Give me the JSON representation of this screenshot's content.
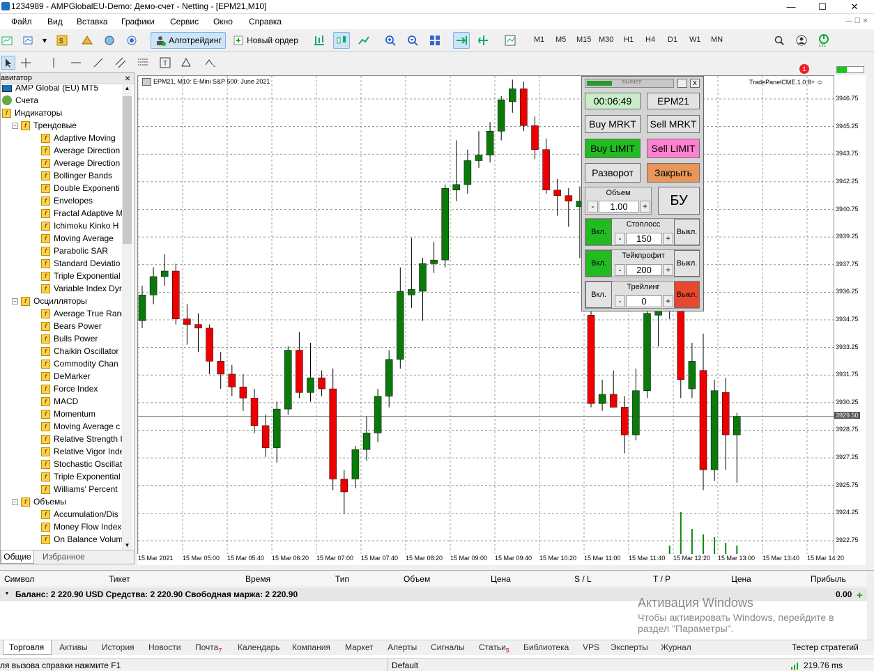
{
  "window": {
    "title": "1234989 - AMPGlobalEU-Demo: Демо-счет - Netting - [EPM21,M10]",
    "minimize": "—",
    "maximize": "☐",
    "close": "✕"
  },
  "menu": [
    "Файл",
    "Вид",
    "Вставка",
    "Графики",
    "Сервис",
    "Окно",
    "Справка"
  ],
  "toolbar": {
    "algotrading": "Алготрейдинг",
    "new_order": "Новый ордер",
    "timeframes": [
      "M1",
      "M5",
      "M15",
      "M30",
      "H1",
      "H4",
      "D1",
      "W1",
      "MN"
    ],
    "notification_count": "1"
  },
  "navigator": {
    "title": "авигатор",
    "close": "×",
    "tabs": [
      "Общие",
      "Избранное"
    ],
    "items": [
      {
        "label": "AMP Global (EU) MT5",
        "level": 0,
        "icon": "terminal-icon"
      },
      {
        "label": "Счета",
        "level": 0,
        "icon": "accounts-icon"
      },
      {
        "label": "Индикаторы",
        "level": 0,
        "icon": "indicator-icon"
      },
      {
        "label": "Трендовые",
        "level": 1,
        "icon": "indicator-icon"
      },
      {
        "label": "Adaptive Moving",
        "level": 2,
        "icon": "indicator-icon"
      },
      {
        "label": "Average Direction",
        "level": 2,
        "icon": "indicator-icon"
      },
      {
        "label": "Average Direction",
        "level": 2,
        "icon": "indicator-icon"
      },
      {
        "label": "Bollinger Bands",
        "level": 2,
        "icon": "indicator-icon"
      },
      {
        "label": "Double Exponenti",
        "level": 2,
        "icon": "indicator-icon"
      },
      {
        "label": "Envelopes",
        "level": 2,
        "icon": "indicator-icon"
      },
      {
        "label": "Fractal Adaptive M",
        "level": 2,
        "icon": "indicator-icon"
      },
      {
        "label": "Ichimoku Kinko H",
        "level": 2,
        "icon": "indicator-icon"
      },
      {
        "label": "Moving Average",
        "level": 2,
        "icon": "indicator-icon"
      },
      {
        "label": "Parabolic SAR",
        "level": 2,
        "icon": "indicator-icon"
      },
      {
        "label": "Standard Deviatio",
        "level": 2,
        "icon": "indicator-icon"
      },
      {
        "label": "Triple Exponential",
        "level": 2,
        "icon": "indicator-icon"
      },
      {
        "label": "Variable Index Dyr",
        "level": 2,
        "icon": "indicator-icon"
      },
      {
        "label": "Осцилляторы",
        "level": 1,
        "icon": "indicator-icon"
      },
      {
        "label": "Average True Rang",
        "level": 2,
        "icon": "indicator-icon"
      },
      {
        "label": "Bears Power",
        "level": 2,
        "icon": "indicator-icon"
      },
      {
        "label": "Bulls Power",
        "level": 2,
        "icon": "indicator-icon"
      },
      {
        "label": "Chaikin Oscillator",
        "level": 2,
        "icon": "indicator-icon"
      },
      {
        "label": "Commodity Chan",
        "level": 2,
        "icon": "indicator-icon"
      },
      {
        "label": "DeMarker",
        "level": 2,
        "icon": "indicator-icon"
      },
      {
        "label": "Force Index",
        "level": 2,
        "icon": "indicator-icon"
      },
      {
        "label": "MACD",
        "level": 2,
        "icon": "indicator-icon"
      },
      {
        "label": "Momentum",
        "level": 2,
        "icon": "indicator-icon"
      },
      {
        "label": "Moving Average c",
        "level": 2,
        "icon": "indicator-icon"
      },
      {
        "label": "Relative Strength I",
        "level": 2,
        "icon": "indicator-icon"
      },
      {
        "label": "Relative Vigor Inde",
        "level": 2,
        "icon": "indicator-icon"
      },
      {
        "label": "Stochastic Oscillat",
        "level": 2,
        "icon": "indicator-icon"
      },
      {
        "label": "Triple Exponential",
        "level": 2,
        "icon": "indicator-icon"
      },
      {
        "label": "Williams' Percent",
        "level": 2,
        "icon": "indicator-icon"
      },
      {
        "label": "Объемы",
        "level": 1,
        "icon": "indicator-icon"
      },
      {
        "label": "Accumulation/Dis",
        "level": 2,
        "icon": "indicator-icon"
      },
      {
        "label": "Money Flow Index",
        "level": 2,
        "icon": "indicator-icon"
      },
      {
        "label": "On Balance Volum",
        "level": 2,
        "icon": "indicator-icon"
      }
    ]
  },
  "chart": {
    "info": "EPM21, M10:  E-Mini S&P 500: June 2021",
    "tradepanel_label": "TradePanelCME.1.0.8+",
    "price_labels": [
      "3946.75",
      "3945.25",
      "3943.75",
      "3942.25",
      "3940.75",
      "3939.25",
      "3937.75",
      "3936.25",
      "3934.75",
      "3933.25",
      "3931.75",
      "3930.25",
      "3928.75",
      "3927.25",
      "3925.75",
      "3924.25",
      "3922.75"
    ],
    "current_price": "3929.50",
    "time_labels": [
      "15 Mar 2021",
      "15 Mar 05:00",
      "15 Mar 05:40",
      "15 Mar 06:20",
      "15 Mar 07:00",
      "15 Mar 07:40",
      "15 Mar 08:20",
      "15 Mar 09:00",
      "15 Mar 09:40",
      "15 Mar 10:20",
      "15 Mar 11:00",
      "15 Mar 11:40",
      "15 Mar 12:20",
      "15 Mar 13:00",
      "15 Mar 13:40",
      "15 Mar 14:20"
    ],
    "colors": {
      "bull": "#0a7a0a",
      "bear": "#ee0000",
      "grid": "#777777",
      "volume": "#0a8a0a"
    }
  },
  "chart_data": {
    "type": "candlestick",
    "y_range": [
      3921.5,
      3948.0
    ],
    "candles": [
      {
        "o": 3934.7,
        "h": 3936.6,
        "l": 3934.3,
        "c": 3936.1
      },
      {
        "o": 3936.1,
        "h": 3937.6,
        "l": 3935.6,
        "c": 3937.1
      },
      {
        "o": 3937.1,
        "h": 3938.3,
        "l": 3936.6,
        "c": 3937.4
      },
      {
        "o": 3937.4,
        "h": 3937.8,
        "l": 3934.5,
        "c": 3934.8
      },
      {
        "o": 3934.8,
        "h": 3935.6,
        "l": 3933.4,
        "c": 3934.5
      },
      {
        "o": 3934.5,
        "h": 3935.1,
        "l": 3933.0,
        "c": 3934.3
      },
      {
        "o": 3934.3,
        "h": 3934.5,
        "l": 3931.8,
        "c": 3932.5
      },
      {
        "o": 3932.5,
        "h": 3933.0,
        "l": 3931.0,
        "c": 3931.8
      },
      {
        "o": 3931.8,
        "h": 3932.3,
        "l": 3930.6,
        "c": 3931.1
      },
      {
        "o": 3931.1,
        "h": 3931.8,
        "l": 3929.8,
        "c": 3930.5
      },
      {
        "o": 3930.5,
        "h": 3931.0,
        "l": 3928.6,
        "c": 3929.0
      },
      {
        "o": 3929.0,
        "h": 3929.6,
        "l": 3927.3,
        "c": 3927.8
      },
      {
        "o": 3927.8,
        "h": 3930.3,
        "l": 3927.0,
        "c": 3929.9
      },
      {
        "o": 3929.9,
        "h": 3933.3,
        "l": 3929.6,
        "c": 3933.1
      },
      {
        "o": 3933.1,
        "h": 3934.1,
        "l": 3930.5,
        "c": 3930.8
      },
      {
        "o": 3930.8,
        "h": 3933.5,
        "l": 3930.3,
        "c": 3931.6
      },
      {
        "o": 3931.6,
        "h": 3932.0,
        "l": 3930.6,
        "c": 3931.0
      },
      {
        "o": 3931.0,
        "h": 3932.1,
        "l": 3925.5,
        "c": 3926.1
      },
      {
        "o": 3926.1,
        "h": 3926.6,
        "l": 3924.2,
        "c": 3925.4
      },
      {
        "o": 3926.1,
        "h": 3927.9,
        "l": 3925.6,
        "c": 3927.7
      },
      {
        "o": 3927.7,
        "h": 3929.5,
        "l": 3927.1,
        "c": 3928.6
      },
      {
        "o": 3928.6,
        "h": 3931.0,
        "l": 3928.1,
        "c": 3930.6
      },
      {
        "o": 3930.6,
        "h": 3933.1,
        "l": 3930.0,
        "c": 3932.6
      },
      {
        "o": 3932.6,
        "h": 3937.6,
        "l": 3932.1,
        "c": 3936.3
      },
      {
        "o": 3936.1,
        "h": 3939.2,
        "l": 3935.4,
        "c": 3936.4
      },
      {
        "o": 3936.3,
        "h": 3938.1,
        "l": 3934.7,
        "c": 3937.8
      },
      {
        "o": 3937.8,
        "h": 3939.0,
        "l": 3937.3,
        "c": 3938.0
      },
      {
        "o": 3938.0,
        "h": 3942.1,
        "l": 3937.6,
        "c": 3941.9
      },
      {
        "o": 3941.8,
        "h": 3944.5,
        "l": 3941.2,
        "c": 3942.1
      },
      {
        "o": 3942.1,
        "h": 3944.0,
        "l": 3941.6,
        "c": 3943.4
      },
      {
        "o": 3943.4,
        "h": 3945.0,
        "l": 3943.0,
        "c": 3943.7
      },
      {
        "o": 3943.7,
        "h": 3945.5,
        "l": 3943.3,
        "c": 3945.0
      },
      {
        "o": 3945.0,
        "h": 3946.9,
        "l": 3944.5,
        "c": 3946.7
      },
      {
        "o": 3946.6,
        "h": 3947.8,
        "l": 3946.0,
        "c": 3947.3
      },
      {
        "o": 3947.3,
        "h": 3947.7,
        "l": 3945.0,
        "c": 3945.3
      },
      {
        "o": 3945.3,
        "h": 3945.8,
        "l": 3943.5,
        "c": 3944.0
      },
      {
        "o": 3944.0,
        "h": 3944.6,
        "l": 3941.6,
        "c": 3941.8
      },
      {
        "o": 3941.8,
        "h": 3942.4,
        "l": 3940.4,
        "c": 3941.5
      },
      {
        "o": 3941.5,
        "h": 3941.9,
        "l": 3939.8,
        "c": 3941.2
      },
      {
        "o": 3940.9,
        "h": 3942.0,
        "l": 3938.1,
        "c": 3941.2
      },
      {
        "o": 3935.0,
        "h": 3935.6,
        "l": 3930.0,
        "c": 3930.2
      },
      {
        "o": 3930.2,
        "h": 3931.5,
        "l": 3929.8,
        "c": 3930.7
      },
      {
        "o": 3930.7,
        "h": 3932.0,
        "l": 3930.0,
        "c": 3930.0
      },
      {
        "o": 3930.0,
        "h": 3930.6,
        "l": 3927.5,
        "c": 3928.5
      },
      {
        "o": 3928.5,
        "h": 3932.1,
        "l": 3928.2,
        "c": 3930.9
      },
      {
        "o": 3930.9,
        "h": 3935.4,
        "l": 3930.5,
        "c": 3935.1
      },
      {
        "o": 3935.0,
        "h": 3936.4,
        "l": 3933.3,
        "c": 3936.0
      },
      {
        "o": 3936.2,
        "h": 3937.0,
        "l": 3934.8,
        "c": 3936.0
      },
      {
        "o": 3936.5,
        "h": 3937.0,
        "l": 3930.5,
        "c": 3931.5
      },
      {
        "o": 3931.0,
        "h": 3933.5,
        "l": 3930.5,
        "c": 3932.5
      },
      {
        "o": 3932.0,
        "h": 3934.0,
        "l": 3925.5,
        "c": 3926.6
      },
      {
        "o": 3926.6,
        "h": 3931.5,
        "l": 3926.0,
        "c": 3930.9
      },
      {
        "o": 3930.8,
        "h": 3931.6,
        "l": 3926.6,
        "c": 3928.5
      },
      {
        "o": 3928.5,
        "h": 3929.7,
        "l": 3925.9,
        "c": 3929.5
      }
    ],
    "volumes": [
      2,
      2,
      2,
      3,
      2,
      2,
      3,
      2,
      3,
      2,
      2,
      3,
      3,
      2,
      3,
      2,
      2,
      3,
      2,
      3,
      3,
      2,
      3,
      3,
      2,
      3,
      2,
      3,
      3,
      2,
      3,
      2,
      3,
      3,
      2,
      3,
      2,
      2,
      3,
      2,
      3,
      2,
      2,
      3,
      2,
      3,
      3,
      6,
      18,
      12,
      10,
      9,
      7,
      6
    ]
  },
  "trade_panel": {
    "timer_header": "ТАЙМЕР",
    "timer": "00:06:49",
    "symbol": "EPM21",
    "buy_market": "Buy MRKT",
    "sell_market": "Sell MRKT",
    "buy_limit": "Buy LIMIT",
    "sell_limit": "Sell LIMIT",
    "reverse": "Разворот",
    "close": "Закрыть",
    "volume_label": "Объем",
    "volume_value": "1.00",
    "breakeven": "БУ",
    "stoploss_label": "Стоплосс",
    "stoploss_value": "150",
    "takeprofit_label": "Тейкпрофит",
    "takeprofit_value": "200",
    "trailing_label": "Трейлинг",
    "trailing_value": "0",
    "on": "Вкл.",
    "off": "Выкл.",
    "minus": "-",
    "plus": "+",
    "close_x": "x",
    "colors": {
      "green": "#22bb22",
      "pink": "#ff80d0",
      "orange": "#e8965a",
      "red": "#e84830",
      "gray": "#e3e3e3"
    }
  },
  "terminal": {
    "columns": [
      "Символ",
      "Тикет",
      "Время",
      "Тип",
      "Объем",
      "Цена",
      "S / L",
      "T / P",
      "Цена",
      "Прибыль"
    ],
    "balance": "Баланс: 2 220.90 USD  Средства: 2 220.90  Свободная маржа: 2 220.90",
    "profit": "0.00",
    "watermark_title": "Активация Windows",
    "watermark_line1": "Чтобы активировать Windows, перейдите в",
    "watermark_line2": "раздел \"Параметры\".",
    "tabs": [
      {
        "label": "Торговля",
        "badge": ""
      },
      {
        "label": "Активы",
        "badge": ""
      },
      {
        "label": "История",
        "badge": ""
      },
      {
        "label": "Новости",
        "badge": ""
      },
      {
        "label": "Почта",
        "badge": "7"
      },
      {
        "label": "Календарь",
        "badge": ""
      },
      {
        "label": "Компания",
        "badge": ""
      },
      {
        "label": "Маркет",
        "badge": ""
      },
      {
        "label": "Алерты",
        "badge": ""
      },
      {
        "label": "Сигналы",
        "badge": ""
      },
      {
        "label": "Статьи",
        "badge": "5"
      },
      {
        "label": "Библиотека",
        "badge": ""
      },
      {
        "label": "VPS",
        "badge": ""
      },
      {
        "label": "Эксперты",
        "badge": ""
      },
      {
        "label": "Журнал",
        "badge": ""
      }
    ],
    "strategy_tester": "Тестер стратегий"
  },
  "statusbar": {
    "help": "ля вызова справки нажмите F1",
    "profile": "Default",
    "ping": "219.76 ms"
  }
}
